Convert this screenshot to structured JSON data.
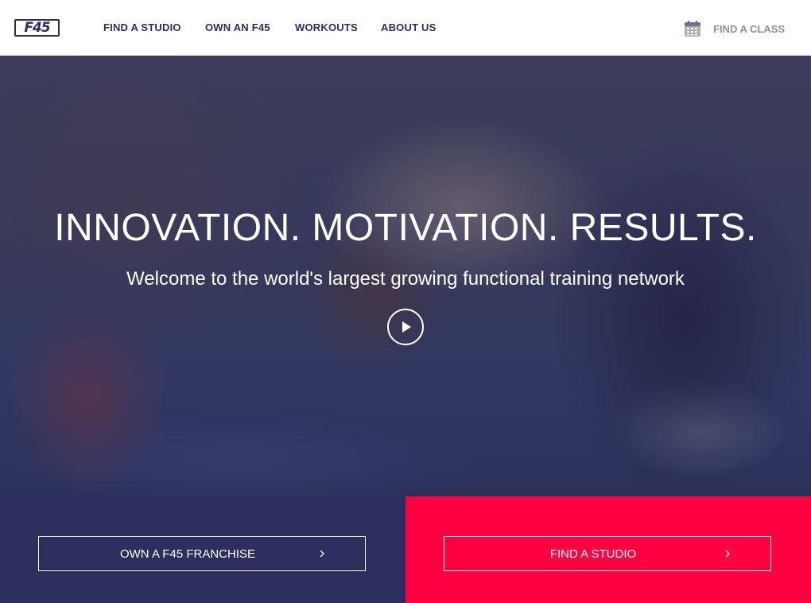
{
  "brand": {
    "logo_text": "F45"
  },
  "nav": {
    "links": [
      {
        "label": "FIND A STUDIO"
      },
      {
        "label": "OWN AN F45"
      },
      {
        "label": "WORKOUTS"
      },
      {
        "label": "ABOUT US"
      }
    ],
    "find_class": {
      "label": "FIND A CLASS",
      "icon": "calendar-icon"
    }
  },
  "hero": {
    "title": "INNOVATION. MOTIVATION. RESULTS.",
    "subtitle": "Welcome to the world's largest growing functional training network",
    "play_icon": "play-icon"
  },
  "cta": {
    "franchise": {
      "label": "OWN A F45 FRANCHISE",
      "icon": "chevron-right-icon"
    },
    "studio": {
      "label": "FIND A STUDIO",
      "icon": "chevron-right-icon"
    }
  },
  "colors": {
    "navy": "#2c2f5e",
    "red": "#ff0040",
    "muted": "#8d8f9c",
    "white": "#ffffff"
  }
}
